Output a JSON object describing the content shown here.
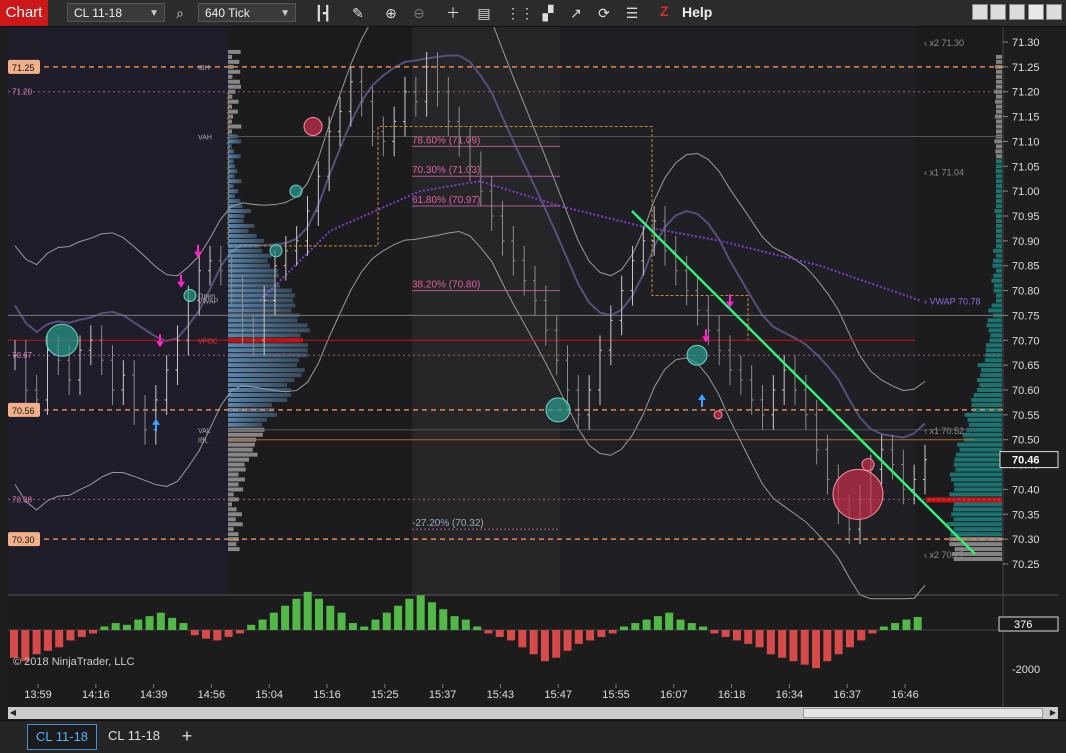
{
  "toolbar": {
    "chart_label": "Chart",
    "instrument": "CL 11-18",
    "period": "640 Tick",
    "help_label": "Help",
    "logo": "Z"
  },
  "icons": [
    "search-icon",
    "bar-type-icon",
    "draw-pencil-icon",
    "zoom-in-icon",
    "zoom-out-icon",
    "crosshair-icon",
    "properties-icon",
    "data-series-icon",
    "strategies-icon",
    "indicators-icon",
    "refresh-icon",
    "object-list-icon",
    "minimize-icon",
    "restore-icon",
    "maximize-icon",
    "close-icon"
  ],
  "copyright": "© 2018 NinjaTrader, LLC",
  "tabs": [
    {
      "label": "CL 11-18",
      "active": true
    },
    {
      "label": "CL 11-18",
      "active": false
    }
  ],
  "tab_add": "+",
  "colors": {
    "trendline": "#33ee77",
    "up_bubble": "#2a9d8f",
    "down_bubble": "#c22f4a",
    "arrow_up": "#3aa0ff",
    "arrow_down": "#ff22cc",
    "vpoc": "#cc1111",
    "orange_level": "#e8884a"
  },
  "chart_data": [
    {
      "type": "line",
      "title": "",
      "instrument": "CL 11-18",
      "period": "640 Tick",
      "ylim": [
        70.2,
        71.3
      ],
      "y_ticks": [
        "71.30",
        "71.25",
        "71.20",
        "71.15",
        "71.10",
        "71.05",
        "71.00",
        "70.95",
        "70.90",
        "70.85",
        "70.80",
        "70.75",
        "70.70",
        "70.65",
        "70.60",
        "70.55",
        "70.50",
        "70.45",
        "70.40",
        "70.35",
        "70.30",
        "70.25"
      ],
      "x_ticks": [
        "13:59",
        "14:16",
        "14:39",
        "14:56",
        "15:04",
        "15:16",
        "15:25",
        "15:37",
        "15:43",
        "15:47",
        "15:55",
        "16:07",
        "16:18",
        "16:34",
        "16:37",
        "16:46"
      ],
      "last_price": "70.46",
      "left_markers": [
        {
          "price": "71.25",
          "style": "orange-box"
        },
        {
          "price": "71.20",
          "style": "pink-text"
        },
        {
          "price": "70.67",
          "style": "pink-text"
        },
        {
          "price": "70.56",
          "style": "orange-box"
        },
        {
          "price": "70.38",
          "style": "pink-text"
        },
        {
          "price": "70.30",
          "style": "orange-box"
        }
      ],
      "level_labels": [
        {
          "label": "IBH",
          "price": 71.25
        },
        {
          "label": "VAH",
          "price": 71.11
        },
        {
          "label": "Open",
          "price": 70.79
        },
        {
          "label": "VWAP",
          "price": 70.78
        },
        {
          "label": "VPOC",
          "price": 70.7
        },
        {
          "label": "VAL",
          "price": 70.52
        },
        {
          "label": "IBL",
          "price": 70.5
        }
      ],
      "right_labels": [
        "x2 71.30",
        "x1 71.04",
        "VWAP 70.78",
        "x1 70.52",
        "x2 70.27"
      ],
      "fib_levels": [
        {
          "label": "78.60% (71.09)",
          "price": 71.09
        },
        {
          "label": "70.30% (71.03)",
          "price": 71.03
        },
        {
          "label": "61.80% (70.97)",
          "price": 70.97
        },
        {
          "label": "38.20% (70.80)",
          "price": 70.8
        },
        {
          "label": "-27.20% (70.32)",
          "price": 70.32
        }
      ],
      "series": [
        {
          "name": "Close",
          "values": [
            70.67,
            70.6,
            70.58,
            70.68,
            70.66,
            70.62,
            70.68,
            70.7,
            70.66,
            70.6,
            70.63,
            70.56,
            70.52,
            70.58,
            70.64,
            70.7,
            70.78,
            70.84,
            70.86,
            70.84,
            70.8,
            70.72,
            70.7,
            70.78,
            70.85,
            70.88,
            70.9,
            70.96,
            71.03,
            71.12,
            71.16,
            71.22,
            71.18,
            71.12,
            71.1,
            71.14,
            71.2,
            71.18,
            71.25,
            71.2,
            71.14,
            71.1,
            71.05,
            71.0,
            70.95,
            70.9,
            70.86,
            70.82,
            70.78,
            70.72,
            70.66,
            70.6,
            70.55,
            70.6,
            70.68,
            70.74,
            70.8,
            70.86,
            70.9,
            70.94,
            70.88,
            70.84,
            70.8,
            70.76,
            70.72,
            70.68,
            70.64,
            70.62,
            70.58,
            70.55,
            70.6,
            70.64,
            70.6,
            70.55,
            70.48,
            70.42,
            70.36,
            70.32,
            70.38,
            70.44,
            70.48,
            70.45,
            70.4,
            70.42,
            70.46
          ]
        }
      ]
    },
    {
      "type": "bar",
      "title": "",
      "ylim": [
        -2000,
        1500
      ],
      "y_ticks": [
        "376",
        "-2000"
      ],
      "last_value": "376",
      "values": [
        -800,
        -900,
        -700,
        -600,
        -500,
        -300,
        -200,
        -100,
        100,
        200,
        150,
        300,
        400,
        500,
        350,
        200,
        -150,
        -250,
        -300,
        -200,
        -100,
        150,
        300,
        500,
        700,
        900,
        1100,
        900,
        700,
        500,
        200,
        100,
        300,
        500,
        700,
        900,
        1000,
        800,
        600,
        400,
        300,
        100,
        -100,
        -200,
        -300,
        -500,
        -700,
        -900,
        -800,
        -600,
        -400,
        -300,
        -200,
        -100,
        100,
        200,
        300,
        400,
        500,
        300,
        200,
        100,
        -100,
        -200,
        -300,
        -400,
        -500,
        -700,
        -800,
        -900,
        -1000,
        -1100,
        -900,
        -700,
        -500,
        -300,
        -100,
        100,
        200,
        300,
        376
      ]
    }
  ]
}
